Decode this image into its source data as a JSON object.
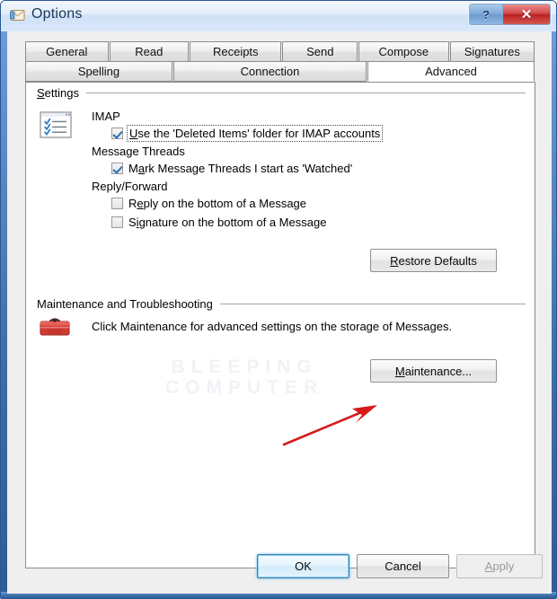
{
  "window": {
    "title": "Options",
    "icon": "mail-options-icon",
    "caption_buttons": [
      {
        "name": "help-button",
        "glyph": "?"
      },
      {
        "name": "close-button",
        "glyph": "✕"
      }
    ]
  },
  "tabs": {
    "row1": [
      {
        "label": "General",
        "active": false
      },
      {
        "label": "Read",
        "active": false
      },
      {
        "label": "Receipts",
        "active": false
      },
      {
        "label": "Send",
        "active": false
      },
      {
        "label": "Compose",
        "active": false
      },
      {
        "label": "Signatures",
        "active": false
      }
    ],
    "row2": [
      {
        "label": "Spelling",
        "active": false
      },
      {
        "label": "Connection",
        "active": false
      },
      {
        "label": "Advanced",
        "active": true
      }
    ]
  },
  "settings_group": {
    "header": "Settings",
    "header_accel": "S",
    "icon": "checklist-window-icon",
    "sections": [
      {
        "label": "IMAP",
        "checkboxes": [
          {
            "label": "Use the 'Deleted Items' folder for IMAP accounts",
            "accel": "U",
            "checked": true,
            "focused": true
          }
        ]
      },
      {
        "label": "Message Threads",
        "checkboxes": [
          {
            "label": "Mark Message Threads I start as 'Watched'",
            "accel": "a",
            "checked": true,
            "focused": false
          }
        ]
      },
      {
        "label": "Reply/Forward",
        "checkboxes": [
          {
            "label": "Reply on the bottom of a Message",
            "accel": "e",
            "checked": false,
            "focused": false
          },
          {
            "label": "Signature on the bottom of a Message",
            "accel": "i",
            "checked": false,
            "focused": false
          }
        ]
      }
    ],
    "restore_button": {
      "label": "Restore Defaults",
      "accel": "R",
      "enabled": true
    }
  },
  "maintenance_group": {
    "header": "Maintenance and Troubleshooting",
    "icon": "red-toolbox-icon",
    "description": "Click Maintenance for advanced settings on the storage of Messages.",
    "maintenance_button": {
      "label": "Maintenance...",
      "accel": "M",
      "enabled": true
    },
    "annotation": {
      "type": "red-arrow",
      "color": "#d61a1a",
      "points_to": "maintenance-button"
    }
  },
  "watermark": {
    "line1": "BLEEPING",
    "line2": "COMPUTER",
    "color": "#f0f2f6"
  },
  "footer": {
    "ok": {
      "label": "OK",
      "default": true,
      "enabled": true
    },
    "cancel": {
      "label": "Cancel",
      "default": false,
      "enabled": true
    },
    "apply": {
      "label": "Apply",
      "default": false,
      "enabled": false,
      "accel": "A"
    }
  },
  "colors": {
    "frame": "#2b5797",
    "titlebar_text": "#19365c",
    "close_red": "#bb2020",
    "accent_blue": "#3c7fb1",
    "arrow_red": "#d61a1a"
  }
}
